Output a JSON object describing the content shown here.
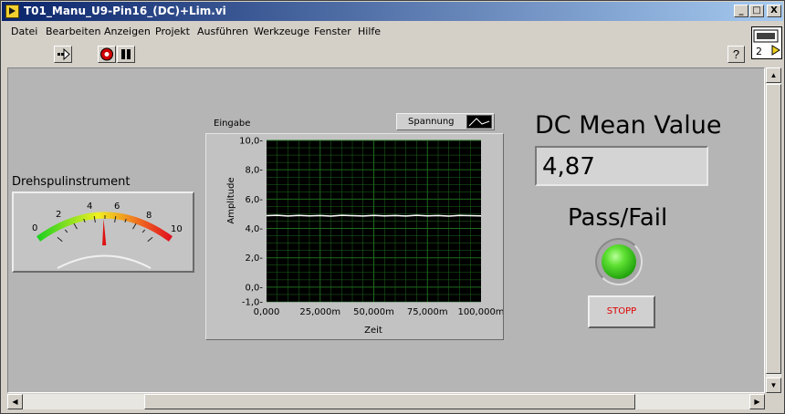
{
  "window": {
    "title": "T01_Manu_U9-Pin16_(DC)+Lim.vi",
    "caption_buttons": [
      "_",
      "□",
      "X"
    ]
  },
  "menu": [
    "Datei",
    "Bearbeiten",
    "Anzeigen",
    "Projekt",
    "Ausführen",
    "Werkzeuge",
    "Fenster",
    "Hilfe"
  ],
  "toolbar": {
    "icons": [
      "run-arrow-icon",
      "abort-icon",
      "pause-icon",
      "help-icon"
    ],
    "help_label": "?"
  },
  "vi_icon_label": "2",
  "meter": {
    "label": "Drehspulinstrument",
    "scale_labels": [
      "0",
      "2",
      "4",
      "6",
      "8",
      "10"
    ],
    "min": 0,
    "max": 10,
    "value": 4.87
  },
  "graph": {
    "label": "Eingabe",
    "legend_name": "Spannung",
    "xlabel": "Zeit",
    "ylabel": "Amplitude",
    "y_ticks": [
      "10,0",
      "8,0",
      "6,0",
      "4,0",
      "2,0",
      "0,0",
      "-1,0"
    ],
    "x_ticks": [
      "0,000",
      "25,000m",
      "50,000m",
      "75,000m",
      "100,000m"
    ]
  },
  "dc": {
    "label": "DC Mean Value",
    "value": "4,87"
  },
  "pass_fail": {
    "label": "Pass/Fail",
    "led_color": "#32d010",
    "state": true
  },
  "stop_button": {
    "label": "STOPP"
  },
  "chart_data": {
    "type": "line",
    "xlabel": "Zeit",
    "ylabel": "Amplitude",
    "xlim": [
      0,
      0.1
    ],
    "ylim": [
      -1,
      10
    ],
    "grid": true,
    "background": "#000000",
    "grid_color": "#1d6b1d",
    "series": [
      {
        "name": "Spannung",
        "color": "#ffffff",
        "x": [
          0,
          0.005,
          0.01,
          0.015,
          0.02,
          0.025,
          0.03,
          0.035,
          0.04,
          0.045,
          0.05,
          0.055,
          0.06,
          0.065,
          0.07,
          0.075,
          0.08,
          0.085,
          0.09,
          0.095,
          0.1
        ],
        "y": [
          4.87,
          4.9,
          4.85,
          4.89,
          4.86,
          4.88,
          4.84,
          4.9,
          4.87,
          4.85,
          4.89,
          4.86,
          4.88,
          4.85,
          4.9,
          4.86,
          4.88,
          4.84,
          4.89,
          4.87,
          4.86
        ]
      }
    ]
  }
}
